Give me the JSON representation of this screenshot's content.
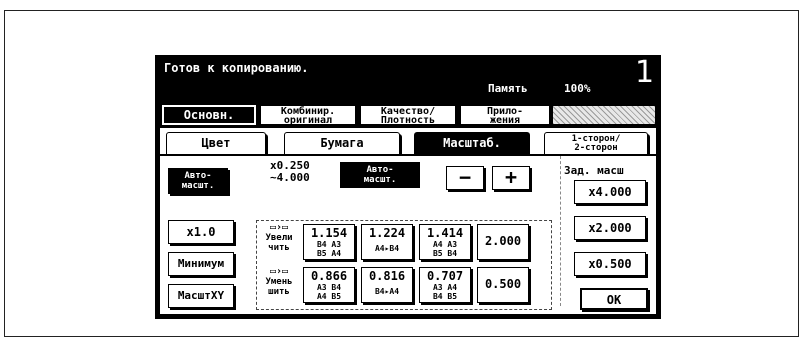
{
  "status": {
    "message": "Готов к копированию.",
    "memory_label": "Память",
    "memory_value": "100%",
    "copy_count": "1"
  },
  "main_tabs": [
    {
      "line1": "Основн.",
      "line2": ""
    },
    {
      "line1": "Комбинир.",
      "line2": "оригинал"
    },
    {
      "line1": "Качество/",
      "line2": "Плотность"
    },
    {
      "line1": "Прило-",
      "line2": "жения"
    }
  ],
  "sub_tabs": [
    {
      "line1": "Цвет",
      "line2": ""
    },
    {
      "line1": "Бумага",
      "line2": ""
    },
    {
      "line1": "Масштаб.",
      "line2": ""
    },
    {
      "line1": "1-сторон/",
      "line2": "2-сторон"
    }
  ],
  "zoom": {
    "auto_button": {
      "line1": "Авто-",
      "line2": "масшт."
    },
    "range": {
      "line1": "x0.250",
      "line2": "~4.000"
    },
    "display": {
      "line1": "Авто-",
      "line2": "масшт."
    },
    "minus": "−",
    "plus": "+",
    "x1": "x1.0",
    "minimum": "Минимум",
    "xy": "МасштXY",
    "enlarge": {
      "icon": "▭›▭",
      "line1": "Увели",
      "line2": "чить",
      "buttons": [
        {
          "value": "1.154",
          "l1": "B4 A3",
          "l2": "B5 A4"
        },
        {
          "value": "1.224",
          "l1": "A4▸B4",
          "l2": ""
        },
        {
          "value": "1.414",
          "l1": "A4 A3",
          "l2": "B5 B4"
        },
        {
          "value": "2.000",
          "l1": "",
          "l2": ""
        }
      ]
    },
    "reduce": {
      "icon": "▭›▭",
      "line1": "Умень",
      "line2": "шить",
      "buttons": [
        {
          "value": "0.866",
          "l1": "A3 B4",
          "l2": "A4 B5"
        },
        {
          "value": "0.816",
          "l1": "B4▸A4",
          "l2": ""
        },
        {
          "value": "0.707",
          "l1": "A3 A4",
          "l2": "B4 B5"
        },
        {
          "value": "0.500",
          "l1": "",
          "l2": ""
        }
      ]
    },
    "preset_title": "Зад. масш",
    "presets": [
      "x4.000",
      "x2.000",
      "x0.500"
    ],
    "ok": "OK"
  }
}
